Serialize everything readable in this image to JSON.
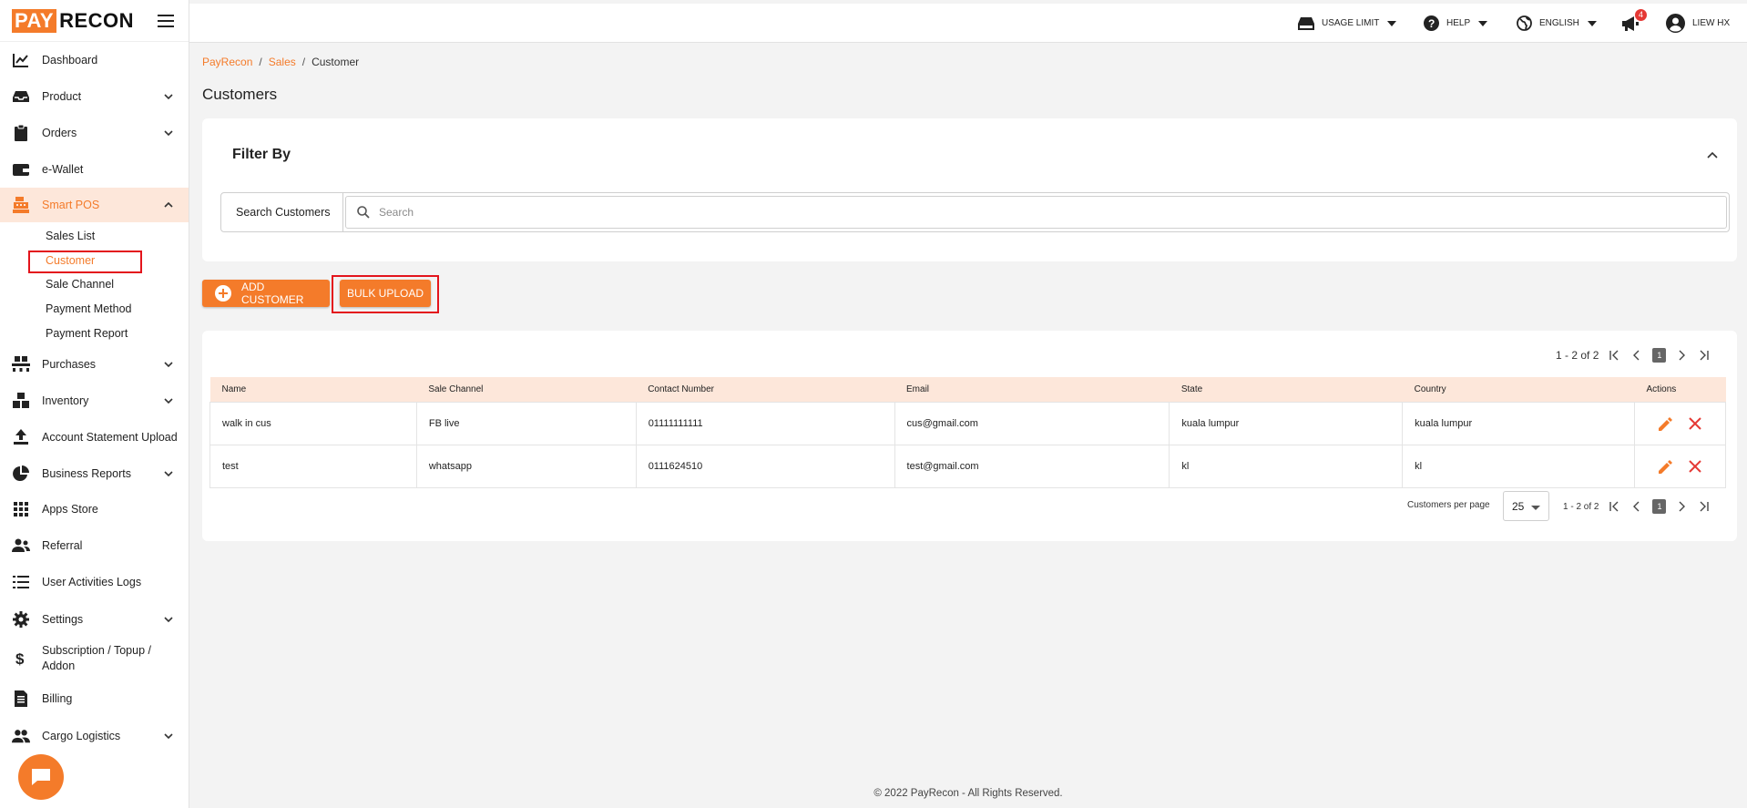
{
  "brand": {
    "part1": "PAY",
    "part2": "RECON",
    "accent": "#f47b2a"
  },
  "sidebar": {
    "items": [
      {
        "label": "Dashboard",
        "icon": "chart-line-icon"
      },
      {
        "label": "Product",
        "icon": "inbox-icon"
      },
      {
        "label": "Orders",
        "icon": "clipboard-icon"
      },
      {
        "label": "e-Wallet",
        "icon": "wallet-icon"
      },
      {
        "label": "Smart POS",
        "icon": "cash-register-icon"
      },
      {
        "label": "Purchases",
        "icon": "pallet-icon"
      },
      {
        "label": "Inventory",
        "icon": "boxes-icon"
      },
      {
        "label": "Account Statement Upload",
        "icon": "upload-icon"
      },
      {
        "label": "Business Reports",
        "icon": "pie-chart-icon"
      },
      {
        "label": "Apps Store",
        "icon": "grid-icon"
      },
      {
        "label": "Referral",
        "icon": "users-icon"
      },
      {
        "label": "User Activities Logs",
        "icon": "list-icon"
      },
      {
        "label": "Settings",
        "icon": "gear-icon"
      },
      {
        "label": "Subscription / Topup /",
        "label2": "Addon",
        "icon": "dollar-icon"
      },
      {
        "label": "Billing",
        "icon": "invoice-icon"
      },
      {
        "label": "Cargo Logistics",
        "icon": "people-icon"
      }
    ],
    "smart_pos_sub": [
      "Sales List",
      "Customer",
      "Sale Channel",
      "Payment Method",
      "Payment Report"
    ]
  },
  "topbar": {
    "usage_limit": "USAGE LIMIT",
    "help": "HELP",
    "language": "ENGLISH",
    "notifications_count": "4",
    "user": "LIEW HX"
  },
  "breadcrumb": {
    "root": "PayRecon",
    "section": "Sales",
    "current": "Customer"
  },
  "page_title": "Customers",
  "filter": {
    "title": "Filter By",
    "search_label": "Search Customers",
    "search_placeholder": "Search"
  },
  "buttons": {
    "add_customer": "ADD CUSTOMER",
    "bulk_upload": "BULK UPLOAD"
  },
  "table": {
    "pager_text": "1 - 2 of 2",
    "page_number": "1",
    "columns": [
      "Name",
      "Sale Channel",
      "Contact Number",
      "Email",
      "State",
      "Country",
      "Actions"
    ],
    "rows": [
      [
        "walk in cus",
        "FB live",
        "01111111111",
        "cus@gmail.com",
        "kuala lumpur",
        "kuala lumpur"
      ],
      [
        "test",
        "whatsapp",
        "0111624510",
        "test@gmail.com",
        "kl",
        "kl"
      ]
    ],
    "per_page_label": "Customers per page",
    "per_page_value": "25"
  },
  "footer": "© 2022 PayRecon - All Rights Reserved."
}
